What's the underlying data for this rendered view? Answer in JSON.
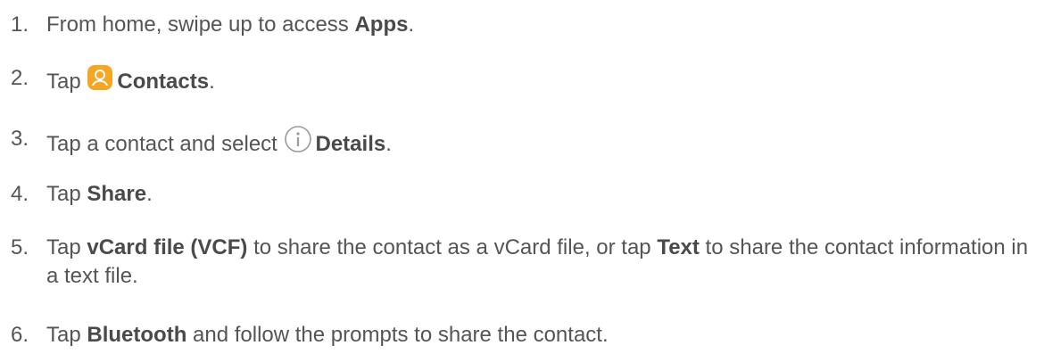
{
  "steps": [
    {
      "num": "1.",
      "parts": [
        "From home, swipe up to access ",
        "Apps",
        "."
      ]
    },
    {
      "num": "2.",
      "parts": [
        "Tap ",
        "Contacts",
        "."
      ],
      "icon": "contacts-app-icon",
      "icon_color": "#f5a623"
    },
    {
      "num": "3.",
      "parts": [
        "Tap a contact and select ",
        "Details",
        "."
      ],
      "icon": "info-icon"
    },
    {
      "num": "4.",
      "parts": [
        "Tap ",
        "Share",
        "."
      ]
    },
    {
      "num": "5.",
      "parts": [
        "Tap ",
        "vCard file (VCF)",
        " to share the contact as a vCard file, or tap ",
        "Text",
        " to share the contact information in a text file."
      ]
    },
    {
      "num": "6.",
      "parts": [
        "Tap ",
        "Bluetooth",
        " and follow the prompts to share the contact."
      ]
    }
  ]
}
